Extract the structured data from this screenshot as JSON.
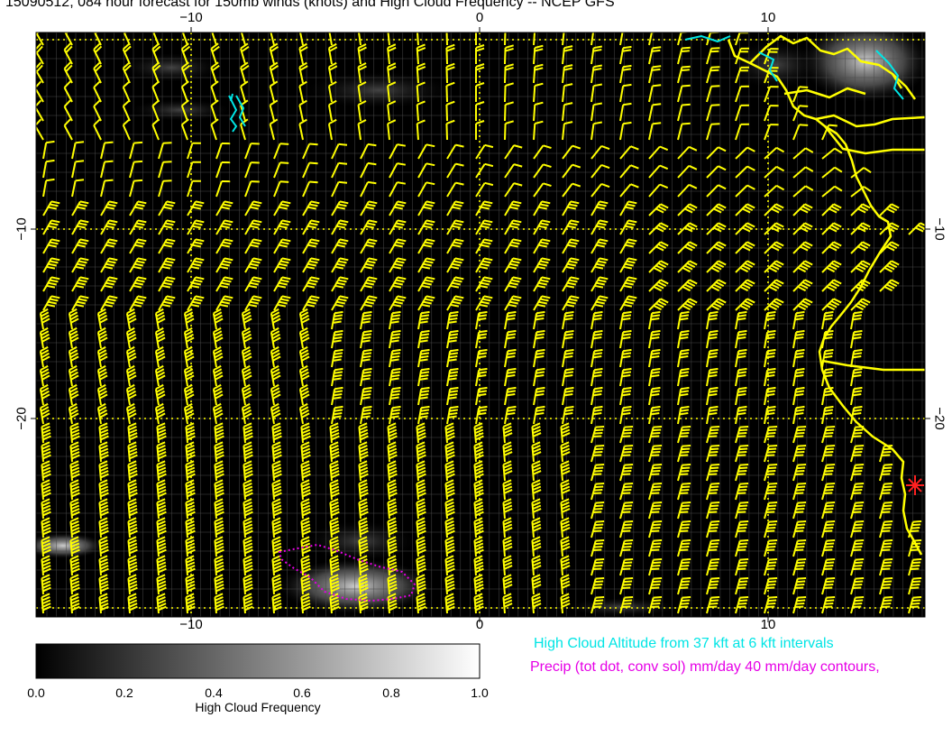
{
  "title": "15090512, 084 hour forecast for 150mb winds (knots) and High Cloud Frequency -- NCEP GFS",
  "axes": {
    "x_ticks_top": [
      "−10",
      "0",
      "10"
    ],
    "x_ticks_bottom": [
      "−10",
      "0",
      "10"
    ],
    "y_ticks_left": [
      "−10",
      "−20"
    ],
    "y_ticks_right": [
      "−10",
      "−20"
    ]
  },
  "colorbar": {
    "label": "High Cloud Frequency",
    "ticks": [
      "0.0",
      "0.2",
      "0.4",
      "0.6",
      "0.8",
      "1.0"
    ]
  },
  "legend": {
    "cyan": "High Cloud Altitude from 37 kft at 6 kft intervals",
    "magenta": "Precip (tot dot, conv sol) mm/day 40 mm/day contours,"
  },
  "colors": {
    "background": "#000000",
    "barbs": "#ffff00",
    "cloud_altitude": "#00e5e5",
    "precip": "#e600e6",
    "marker": "#ff2020"
  },
  "marker_icon": "asterisk-station-marker"
}
